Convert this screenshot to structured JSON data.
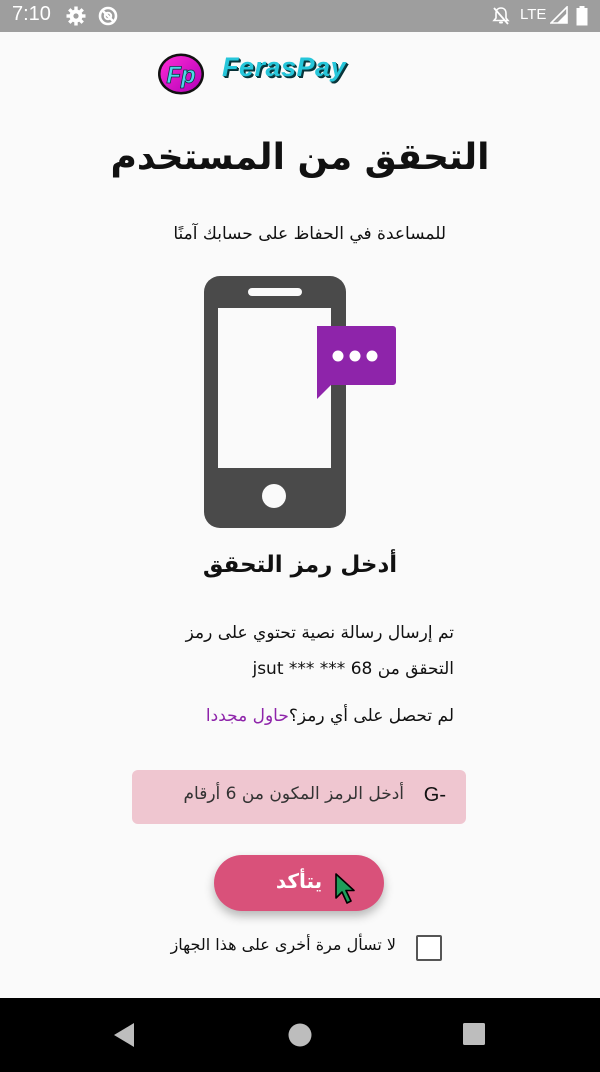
{
  "status_bar": {
    "time": "7:10",
    "network": "LTE",
    "icons": [
      "settings-icon",
      "no-disturb-icon",
      "notifications-off-icon",
      "signal-icon",
      "battery-icon"
    ]
  },
  "brand": {
    "badge": "Fp",
    "name": "FerasPay"
  },
  "page": {
    "title": "التحقق من المستخدم",
    "subtitle": "للمساعدة في الحفاظ على حسابك آمنًا"
  },
  "verification": {
    "heading": "أدخل رمز التحقق",
    "info_line1": "تم إرسال رسالة نصية تحتوي على رمز",
    "info_line2": "التحقق من 68 *** *** jsut",
    "resend_question": "لم تحصل على أي رمز؟",
    "resend_link": "حاول مجددا"
  },
  "code_input": {
    "prefix": "G-",
    "placeholder": "أدخل الرمز المكون من 6 أرقام"
  },
  "confirm_button": {
    "label": "يتأكد"
  },
  "remember": {
    "label": "لا تسأل مرة أخرى على هذا الجهاز",
    "checked": false
  },
  "colors": {
    "accent": "#d9517a",
    "link": "#8e24aa",
    "input_bg": "#efc6d0",
    "chat_bubble": "#8e24aa",
    "phone": "#4a4a4a"
  },
  "nav_bar": [
    "back-icon",
    "home-icon",
    "recents-icon"
  ]
}
